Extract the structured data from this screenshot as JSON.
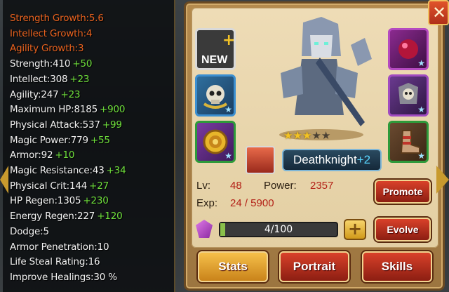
{
  "stats": [
    {
      "label": "Strength Growth:",
      "value": "5.6",
      "bonus": "",
      "highlight": true
    },
    {
      "label": "Intellect Growth:",
      "value": "4",
      "bonus": "",
      "highlight": true
    },
    {
      "label": "Agility Growth:",
      "value": "3",
      "bonus": "",
      "highlight": true
    },
    {
      "label": "Strength:",
      "value": "410",
      "bonus": "+50",
      "highlight": false
    },
    {
      "label": "Intellect:",
      "value": "308",
      "bonus": "+23",
      "highlight": false
    },
    {
      "label": "Agility:",
      "value": "247",
      "bonus": "+23",
      "highlight": false
    },
    {
      "label": "Maximum HP:",
      "value": "8185",
      "bonus": "+900",
      "highlight": false
    },
    {
      "label": "Physical Attack:",
      "value": "537",
      "bonus": "+99",
      "highlight": false
    },
    {
      "label": "Magic Power:",
      "value": "779",
      "bonus": "+55",
      "highlight": false
    },
    {
      "label": "Armor:",
      "value": "92",
      "bonus": "+10",
      "highlight": false
    },
    {
      "label": "Magic Resistance:",
      "value": "43",
      "bonus": "+34",
      "highlight": false
    },
    {
      "label": "Physical Crit:",
      "value": "144",
      "bonus": "+27",
      "highlight": false
    },
    {
      "label": "HP Regen:",
      "value": "1305",
      "bonus": "+230",
      "highlight": false
    },
    {
      "label": "Energy Regen:",
      "value": "227",
      "bonus": "+120",
      "highlight": false
    },
    {
      "label": "Dodge:",
      "value": "5",
      "bonus": "",
      "highlight": false
    },
    {
      "label": "Armor Penetration:",
      "value": "10",
      "bonus": "",
      "highlight": false
    },
    {
      "label": "Life Steal Rating:",
      "value": "16",
      "bonus": "",
      "highlight": false
    },
    {
      "label": "Improve Healings:",
      "value": "30 %",
      "bonus": "",
      "highlight": false
    }
  ],
  "hero": {
    "name": "Deathknight",
    "plus": "+2",
    "stars_filled": 3,
    "stars_total": 5
  },
  "equipment": {
    "new_label": "NEW",
    "add_symbol": "+",
    "slots": [
      "new-slot",
      "skull-amulet-icon",
      "gold-rune-disc-icon",
      "red-orb-icon",
      "skull-armor-icon",
      "iron-boot-icon"
    ]
  },
  "info": {
    "level_label": "Lv:",
    "level_value": "48",
    "power_label": "Power:",
    "power_value": "2357",
    "exp_label": "Exp:",
    "exp_value": "24 / 5900"
  },
  "evolve": {
    "progress_text": "4/100",
    "progress_fraction": 0.04,
    "plus_symbol": "+"
  },
  "buttons": {
    "promote": "Promote",
    "evolve": "Evolve",
    "close": "✕"
  },
  "tabs": [
    {
      "label": "Stats",
      "active": true
    },
    {
      "label": "Portrait",
      "active": false
    },
    {
      "label": "Skills",
      "active": false
    }
  ],
  "colors": {
    "growth_text": "#e8621f",
    "bonus_text": "#6fe03c",
    "value_red": "#b32016",
    "panel_tan": "#eedcb6"
  }
}
